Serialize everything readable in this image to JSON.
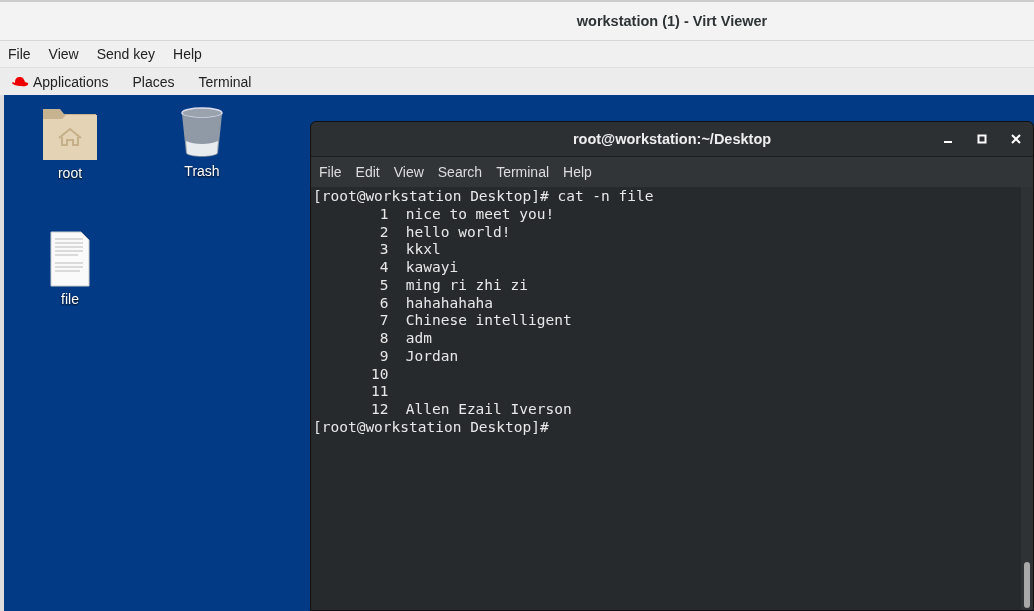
{
  "window": {
    "title": "workstation (1) - Virt Viewer"
  },
  "menu": [
    "File",
    "View",
    "Send key",
    "Help"
  ],
  "panel": {
    "items": [
      "Applications",
      "Places",
      "Terminal"
    ]
  },
  "desktop_icons": [
    {
      "label": "root",
      "kind": "home-folder"
    },
    {
      "label": "Trash",
      "kind": "trash"
    },
    {
      "label": "file",
      "kind": "document"
    }
  ],
  "terminal": {
    "title": "root@workstation:~/Desktop",
    "menu": [
      "File",
      "Edit",
      "View",
      "Search",
      "Terminal",
      "Help"
    ],
    "command": "[root@workstation Desktop]# cat -n file",
    "rows": [
      {
        "number": "1",
        "text": "nice to meet you!"
      },
      {
        "number": "2",
        "text": "hello world!"
      },
      {
        "number": "3",
        "text": "kkxl"
      },
      {
        "number": "4",
        "text": "kawayi"
      },
      {
        "number": "5",
        "text": "ming ri zhi zi"
      },
      {
        "number": "6",
        "text": "hahahahaha"
      },
      {
        "number": "7",
        "text": "Chinese intelligent"
      },
      {
        "number": "8",
        "text": "adm"
      },
      {
        "number": "9",
        "text": "Jordan"
      },
      {
        "number": "10"
      },
      {
        "number": "11"
      },
      {
        "number": "12",
        "text": "Allen Ezail Iverson"
      }
    ],
    "prompt": "[root@workstation Desktop]#"
  }
}
